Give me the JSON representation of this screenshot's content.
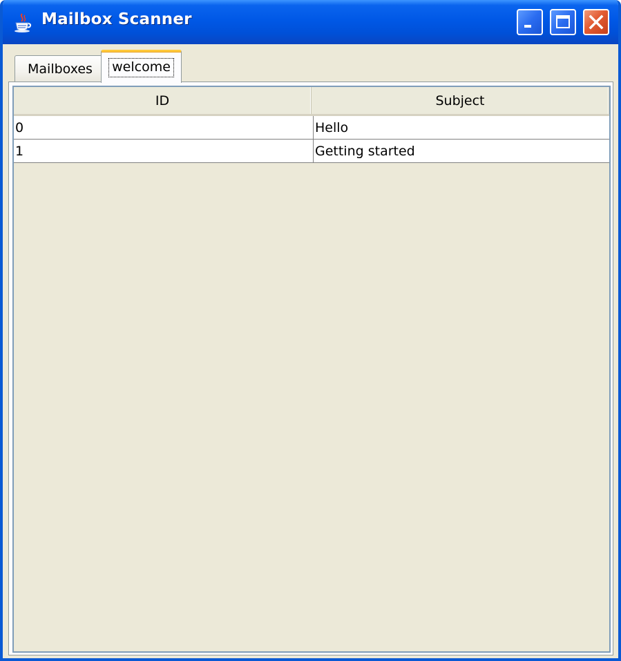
{
  "window": {
    "title": "Mailbox Scanner",
    "app_icon": "java-cup-icon",
    "controls": [
      "minimize-icon",
      "maximize-icon",
      "close-icon"
    ]
  },
  "tabs": [
    {
      "label": "Mailboxes",
      "selected": false
    },
    {
      "label": "welcome",
      "selected": true
    }
  ],
  "table": {
    "columns": [
      "ID",
      "Subject"
    ],
    "rows": [
      {
        "id": "0",
        "subject": "Hello"
      },
      {
        "id": "1",
        "subject": "Getting started"
      }
    ]
  },
  "colors": {
    "titlebar": "#0058e6",
    "window_bg": "#ece9d8",
    "active_tab_highlight": "#ffc83c",
    "close_button": "#e25b32"
  }
}
